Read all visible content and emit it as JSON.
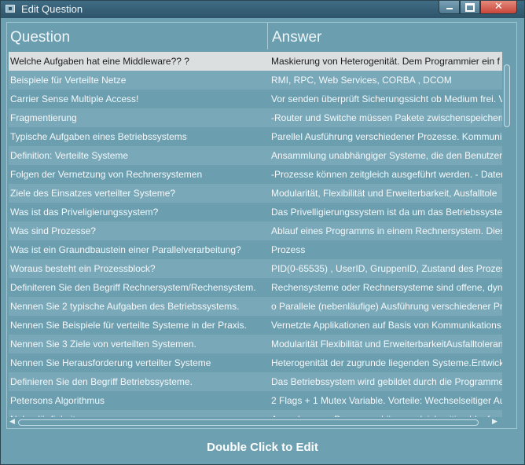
{
  "window": {
    "title": "Edit Question",
    "minimize_glyph": "",
    "maximize_glyph": "",
    "close_glyph": "✕"
  },
  "grid": {
    "columns": [
      "Question",
      "Answer"
    ],
    "rows": [
      {
        "question": "Welche Aufgaben hat eine Middleware?? ?",
        "answer": "Maskierung von Heterogenität. Dem Programmier ein f"
      },
      {
        "question": "Beispiele für Verteilte Netze",
        "answer": "RMI, RPC, Web Services,  CORBA , DCOM"
      },
      {
        "question": "Carrier Sense Multiple Access!",
        "answer": "Vor senden überprüft Sicherungssicht ob Medium frei. V"
      },
      {
        "question": "Fragmentierung",
        "answer": "-Router und Switche müssen Pakete zwischenspeichern"
      },
      {
        "question": "Typische Aufgaben eines Betriebssystems",
        "answer": "Parellel Ausführung verschiedener Prozesse. Kommunik"
      },
      {
        "question": "Definition: Verteilte Systeme",
        "answer": "Ansammlung unabhängiger Systeme, die den Benutzern"
      },
      {
        "question": "Folgen der Vernetzung von Rechnersystemen",
        "answer": "-Prozesse können zeitgleich ausgeführt werden. - Dater"
      },
      {
        "question": "Ziele des Einsatzes verteilter Systeme?",
        "answer": " Modularität, Flexibilität und Erweiterbarkeit, Ausfalltole"
      },
      {
        "question": "Was ist das Priveligierungssystem?",
        "answer": "Das Privelligierungssystem ist da um das Betriebssysten"
      },
      {
        "question": "Was sind Prozesse?",
        "answer": "Ablauf eines Programms in einem Rechnersystem. Diese"
      },
      {
        "question": "Was ist ein Graundbaustein einer Parallelverarbeitung?",
        "answer": "Prozess"
      },
      {
        "question": "Woraus besteht ein Prozessblock?",
        "answer": "PID(0-65535) , UserID, GruppenID, Zustand des Prozess"
      },
      {
        "question": "Definiteren Sie den Begriff Rechnersystem/Rechensystem.",
        "answer": "Rechensysteme oder Rechnersysteme sind offene, dyna"
      },
      {
        "question": "Nennen Sie 2 typische Aufgaben des Betriebssystems.",
        "answer": "o Parallele (nebenläufige) Ausführung verschiedener Pro"
      },
      {
        "question": "Nennen Sie Beispiele für verteilte Systeme in der Praxis.",
        "answer": " Vernetzte Applikationen auf Basis von Kommunikations"
      },
      {
        "question": "Nennen Sie 3 Ziele von verteilten Systemen.",
        "answer": "Modularität Flexibilität und ErweiterbarkeitAusfalltoleran"
      },
      {
        "question": "Nennen Sie Herausforderung verteilter Systeme",
        "answer": "Heterogenität der zugrunde liegenden Systeme.Entwick"
      },
      {
        "question": "Definieren Sie den Begriff Betriebssysteme.",
        "answer": "Das Betriebssystem wird gebildet durch die Programme"
      },
      {
        "question": "Petersons Algorithmus",
        "answer": "2 Flags + 1 Mutex Variable. Vorteile: Wechselseitiger Au"
      },
      {
        "question": "Nebenläufigkeit",
        "answer": "Ausgaben von Prozessen können gleichzeitig ablaufen"
      }
    ]
  },
  "footer": {
    "hint": "Double Click to Edit"
  }
}
